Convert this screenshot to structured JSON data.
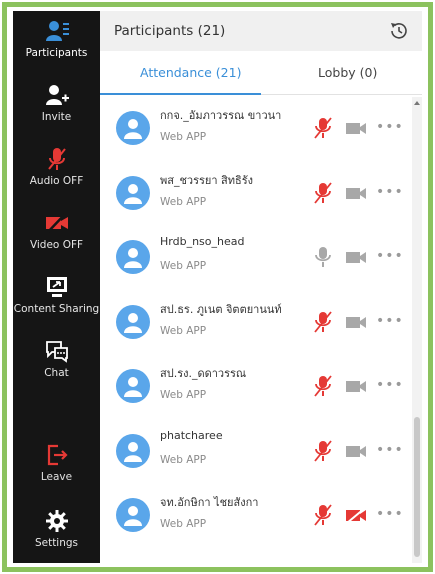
{
  "rail": {
    "participants": "Participants",
    "invite": "Invite",
    "audio": "Audio OFF",
    "video": "Video OFF",
    "content_sharing": "Content Sharing",
    "chat": "Chat",
    "leave": "Leave",
    "settings": "Settings"
  },
  "header": {
    "title": "Participants (21)"
  },
  "tabs": {
    "attendance": "Attendance (21)",
    "lobby": "Lobby (0)"
  },
  "participants": [
    {
      "name": "กกจ._อัมภาวรรณ ขาวนา",
      "sub": "Web APP",
      "mic": "muted",
      "video": "off-gray"
    },
    {
      "name": "พส_ชวรรยา สิทธิรัง",
      "sub": "Web APP",
      "mic": "muted",
      "video": "off-gray"
    },
    {
      "name": "Hrdb_nso_head",
      "sub": "Web APP",
      "mic": "on-gray",
      "video": "off-gray"
    },
    {
      "name": "สป.ธร. ภูเนต จิตตยานนท์",
      "sub": "Web APP",
      "mic": "muted",
      "video": "off-gray"
    },
    {
      "name": "สป.รง._ดดาวรรณ",
      "sub": "Web APP",
      "mic": "muted",
      "video": "off-gray"
    },
    {
      "name": "phatcharee",
      "sub": "Web APP",
      "mic": "muted",
      "video": "off-gray"
    },
    {
      "name": "จท.อักษิกา ไชยสังกา",
      "sub": "Web APP",
      "mic": "muted",
      "video": "off-red"
    }
  ],
  "more_glyph": "•••",
  "colors": {
    "accent": "#3a8fd8",
    "muted_red": "#e53935",
    "rail_bg": "#151515",
    "frame_green": "#8cc25e"
  }
}
